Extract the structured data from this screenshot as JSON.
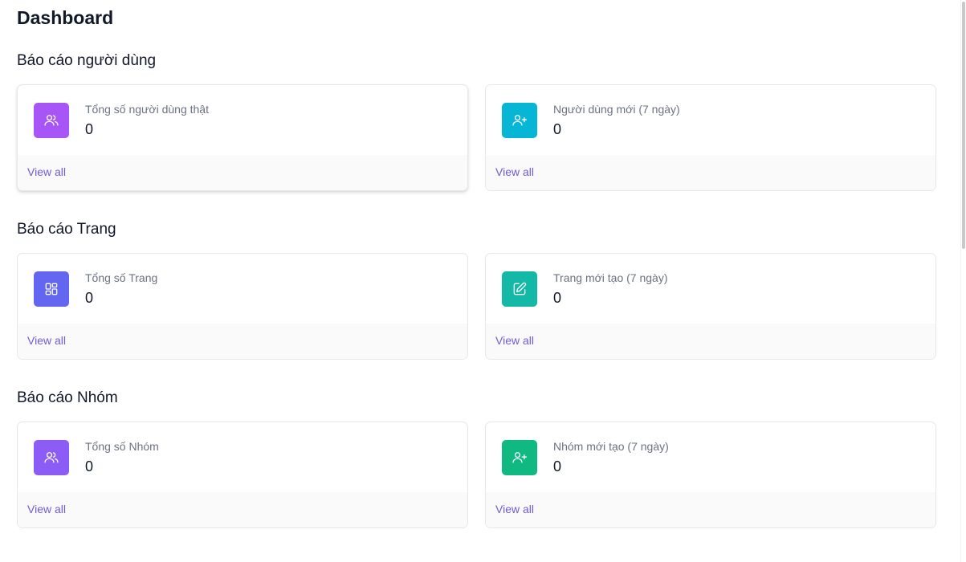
{
  "page": {
    "title": "Dashboard"
  },
  "sections": [
    {
      "title": "Báo cáo người dùng",
      "cards": [
        {
          "label": "Tổng số người dùng thật",
          "value": "0",
          "link": "View all",
          "icon": "users-icon",
          "color": "#a855f7"
        },
        {
          "label": "Người dùng mới (7 ngày)",
          "value": "0",
          "link": "View all",
          "icon": "user-plus-icon",
          "color": "#06b6d4"
        }
      ]
    },
    {
      "title": "Báo cáo Trang",
      "cards": [
        {
          "label": "Tổng số Trang",
          "value": "0",
          "link": "View all",
          "icon": "grid-icon",
          "color": "#6366f1"
        },
        {
          "label": "Trang mới tạo (7 ngày)",
          "value": "0",
          "link": "View all",
          "icon": "edit-icon",
          "color": "#14b8a6"
        }
      ]
    },
    {
      "title": "Báo cáo Nhóm",
      "cards": [
        {
          "label": "Tổng số Nhóm",
          "value": "0",
          "link": "View all",
          "icon": "users-icon",
          "color": "#8b5cf6"
        },
        {
          "label": "Nhóm mới tạo (7 ngày)",
          "value": "0",
          "link": "View all",
          "icon": "user-plus-icon",
          "color": "#10b981"
        }
      ]
    }
  ]
}
